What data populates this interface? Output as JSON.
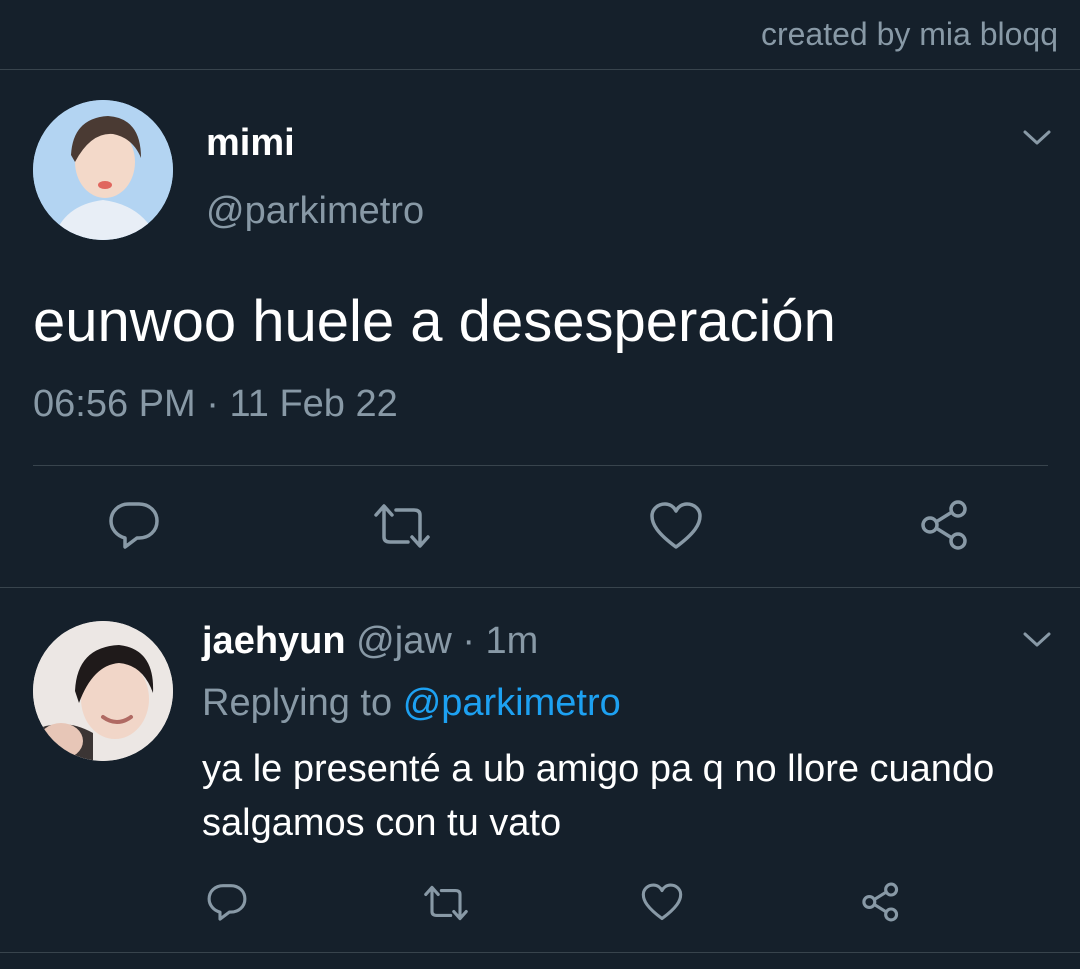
{
  "credit": "created by mia bloqq",
  "tweet": {
    "display_name": "mimi",
    "handle": "@parkimetro",
    "text": "eunwoo huele a desesperación",
    "time": "06:56 PM",
    "separator": "·",
    "date": "11 Feb 22",
    "avatar_icon": "user-avatar"
  },
  "reply": {
    "display_name": "jaehyun",
    "handle": "@jaw",
    "separator": "·",
    "age": "1m",
    "replying_label": "Replying to",
    "replying_to": "@parkimetro",
    "text": "ya le presenté a ub amigo pa q no llore cuando salgamos con tu vato",
    "avatar_icon": "user-avatar"
  },
  "actions": [
    "reply-icon",
    "retweet-icon",
    "like-icon",
    "share-icon"
  ],
  "colors": {
    "background": "#15202b",
    "text": "#ffffff",
    "secondary": "#8899a6",
    "divider": "#38444d",
    "accent": "#1da1f2"
  }
}
